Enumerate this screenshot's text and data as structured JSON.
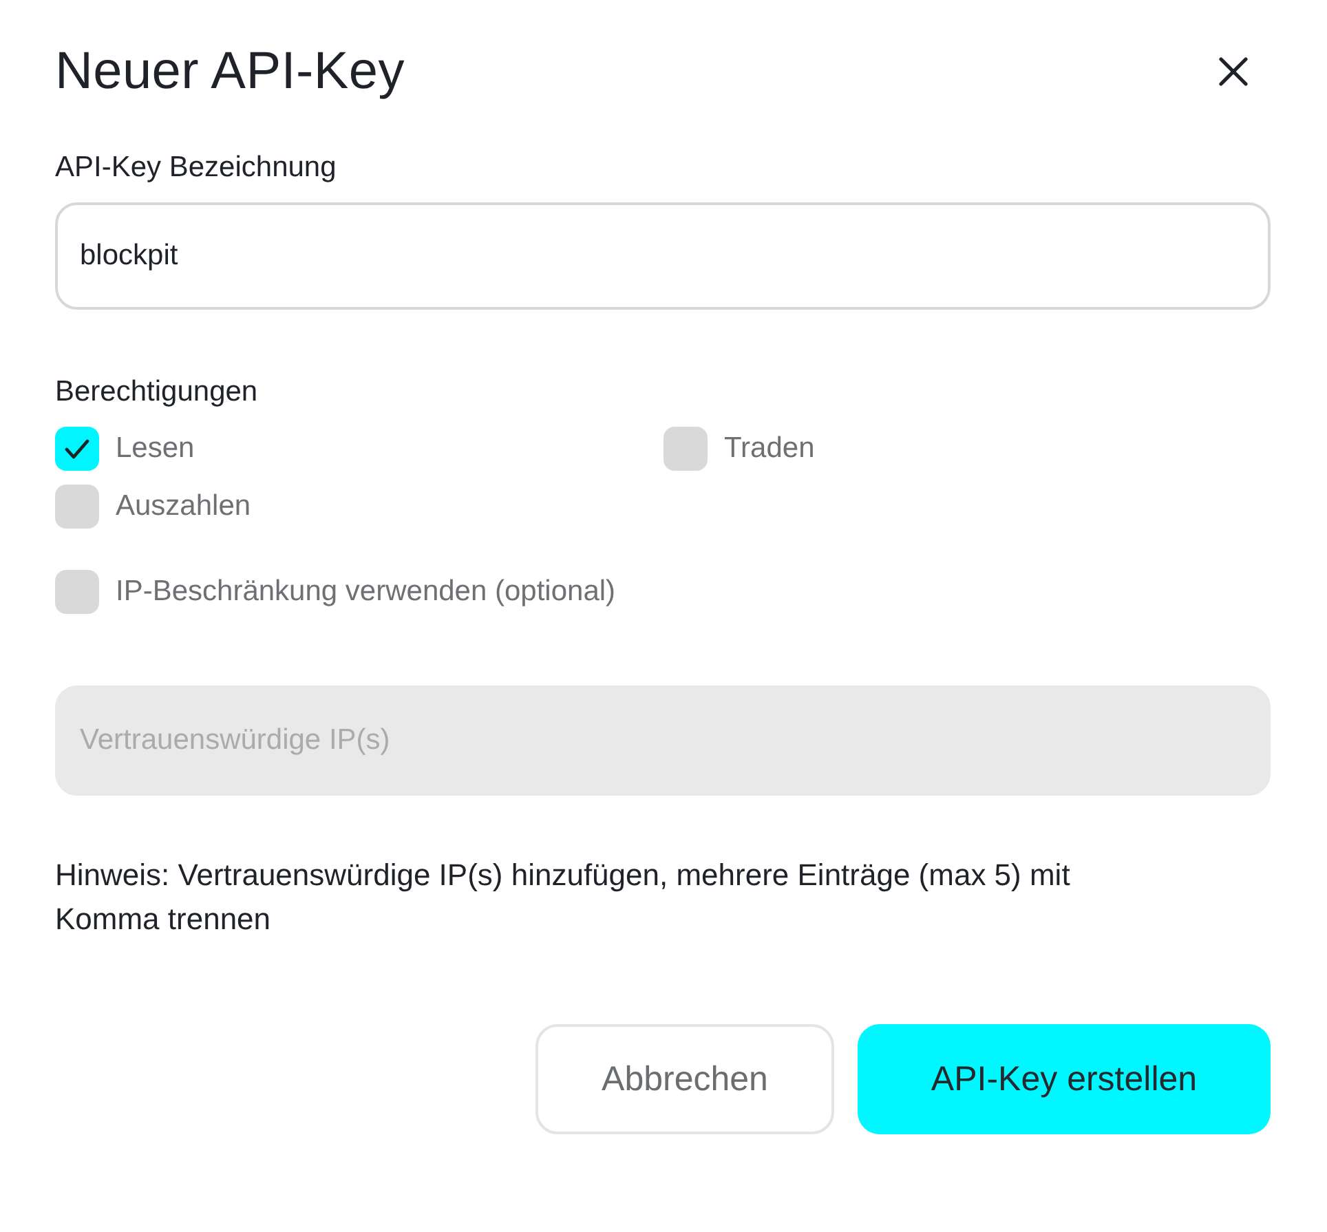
{
  "dialog": {
    "title": "Neuer API-Key"
  },
  "name_field": {
    "label": "API-Key Bezeichnung",
    "value": "blockpit"
  },
  "permissions": {
    "heading": "Berechtigungen",
    "options": [
      {
        "label": "Lesen",
        "checked": true
      },
      {
        "label": "Traden",
        "checked": false
      },
      {
        "label": "Auszahlen",
        "checked": false
      }
    ]
  },
  "ip_restriction": {
    "label": "IP-Beschränkung verwenden (optional)",
    "checked": false
  },
  "ip_field": {
    "placeholder": "Vertrauenswürdige IP(s)",
    "disabled": true
  },
  "hint": "Hinweis: Vertrauenswürdige IP(s) hinzufügen, mehrere Einträge (max 5) mit Komma trennen",
  "buttons": [
    {
      "label": "Abbrechen",
      "kind": "secondary"
    },
    {
      "label": "API-Key erstellen",
      "kind": "primary"
    }
  ]
}
